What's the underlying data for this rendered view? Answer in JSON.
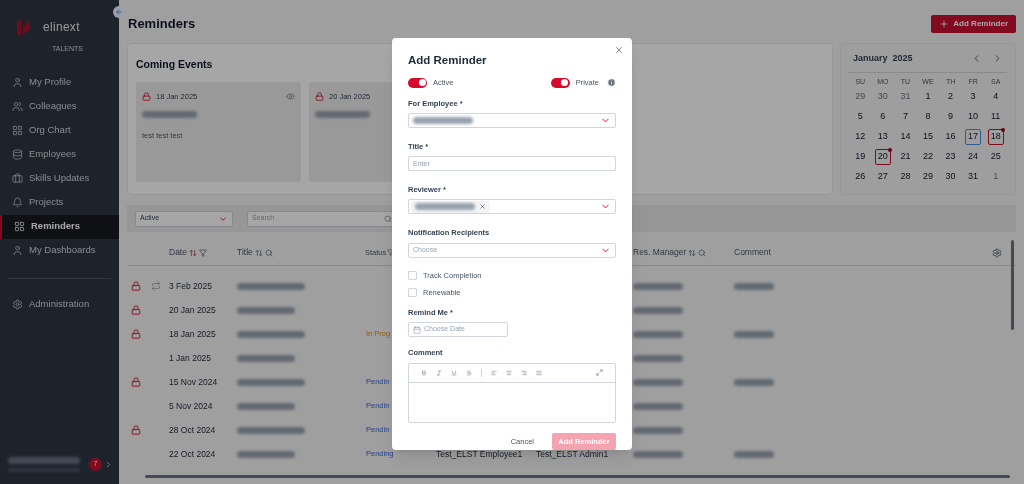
{
  "sidebar": {
    "logo": "elinext",
    "subtitle": "TALENTS",
    "items": [
      {
        "label": "My Profile",
        "selected": false
      },
      {
        "label": "Colleagues",
        "selected": false
      },
      {
        "label": "Org Chart",
        "selected": false
      },
      {
        "label": "Employees",
        "selected": false
      },
      {
        "label": "Skills Updates",
        "selected": false
      },
      {
        "label": "Projects",
        "selected": false
      },
      {
        "label": "Reminders",
        "selected": true
      },
      {
        "label": "My Dashboards",
        "selected": false
      }
    ],
    "admin": {
      "label": "Administration",
      "selected": false
    },
    "notification_count": "7"
  },
  "header": {
    "title": "Reminders",
    "add_button": "Add Reminder"
  },
  "coming_events": {
    "title": "Coming Events",
    "cards": [
      {
        "date": "18 Jan 2025",
        "private": true,
        "watched": true,
        "text": "test test test"
      },
      {
        "date": "20 Jan 2025",
        "private": true,
        "watched": false
      }
    ]
  },
  "calendar": {
    "month": "January",
    "year": "2025",
    "weekdays": [
      "SU",
      "MO",
      "TU",
      "WE",
      "TH",
      "FR",
      "SA"
    ],
    "weeks": [
      [
        {
          "day": "29",
          "outside": true,
          "today": false,
          "event": false
        },
        {
          "day": "30",
          "outside": true,
          "today": false,
          "event": false
        },
        {
          "day": "31",
          "outside": true,
          "today": false,
          "event": false
        },
        {
          "day": "1",
          "outside": false,
          "today": false,
          "event": false
        },
        {
          "day": "2",
          "outside": false,
          "today": false,
          "event": false
        },
        {
          "day": "3",
          "outside": false,
          "today": false,
          "event": false
        },
        {
          "day": "4",
          "outside": false,
          "today": false,
          "event": false
        }
      ],
      [
        {
          "day": "5",
          "outside": false,
          "today": false,
          "event": false
        },
        {
          "day": "6",
          "outside": false,
          "today": false,
          "event": false
        },
        {
          "day": "7",
          "outside": false,
          "today": false,
          "event": false
        },
        {
          "day": "8",
          "outside": false,
          "today": false,
          "event": false
        },
        {
          "day": "9",
          "outside": false,
          "today": false,
          "event": false
        },
        {
          "day": "10",
          "outside": false,
          "today": false,
          "event": false
        },
        {
          "day": "11",
          "outside": false,
          "today": false,
          "event": false
        }
      ],
      [
        {
          "day": "12",
          "outside": false,
          "today": false,
          "event": false
        },
        {
          "day": "13",
          "outside": false,
          "today": false,
          "event": false
        },
        {
          "day": "14",
          "outside": false,
          "today": false,
          "event": false
        },
        {
          "day": "15",
          "outside": false,
          "today": false,
          "event": false
        },
        {
          "day": "16",
          "outside": false,
          "today": false,
          "event": false
        },
        {
          "day": "17",
          "outside": false,
          "today": true,
          "event": false
        },
        {
          "day": "18",
          "outside": false,
          "today": false,
          "event": true
        }
      ],
      [
        {
          "day": "19",
          "outside": false,
          "today": false,
          "event": false
        },
        {
          "day": "20",
          "outside": false,
          "today": false,
          "event": true
        },
        {
          "day": "21",
          "outside": false,
          "today": false,
          "event": false
        },
        {
          "day": "22",
          "outside": false,
          "today": false,
          "event": false
        },
        {
          "day": "23",
          "outside": false,
          "today": false,
          "event": false
        },
        {
          "day": "24",
          "outside": false,
          "today": false,
          "event": false
        },
        {
          "day": "25",
          "outside": false,
          "today": false,
          "event": false
        }
      ],
      [
        {
          "day": "26",
          "outside": false,
          "today": false,
          "event": false
        },
        {
          "day": "27",
          "outside": false,
          "today": false,
          "event": false
        },
        {
          "day": "28",
          "outside": false,
          "today": false,
          "event": false
        },
        {
          "day": "29",
          "outside": false,
          "today": false,
          "event": false
        },
        {
          "day": "30",
          "outside": false,
          "today": false,
          "event": false
        },
        {
          "day": "31",
          "outside": false,
          "today": false,
          "event": false
        },
        {
          "day": "1",
          "outside": true,
          "today": false,
          "event": false
        }
      ]
    ]
  },
  "filters": {
    "status": "Active",
    "search_placeholder": "Search"
  },
  "table": {
    "columns": [
      "Date",
      "Title",
      "Status",
      "Res. Manager",
      "Comment"
    ],
    "rows": [
      {
        "private": true,
        "recurring": true,
        "date": "3 Feb 2025",
        "comment_blurred": true
      },
      {
        "private": true,
        "recurring": false,
        "date": "20 Jan 2025",
        "comment_blurred": false
      },
      {
        "private": true,
        "recurring": false,
        "date": "18 Jan 2025",
        "status": {
          "text": "In Prog",
          "kind": "in_progress"
        },
        "comment_blurred": true
      },
      {
        "private": false,
        "recurring": false,
        "date": "1 Jan 2025",
        "comment_blurred": false
      },
      {
        "private": true,
        "recurring": false,
        "date": "15 Nov 2024",
        "status": {
          "text": "Pendin",
          "kind": "pending"
        },
        "comment_blurred": true
      },
      {
        "private": false,
        "recurring": false,
        "date": "5 Nov 2024",
        "status": {
          "text": "Pendin",
          "kind": "pending"
        },
        "comment_blurred": false
      },
      {
        "private": true,
        "recurring": false,
        "date": "28 Oct 2024",
        "status": {
          "text": "Pendin",
          "kind": "pending"
        },
        "comment_blurred": false
      },
      {
        "private": false,
        "recurring": false,
        "date": "22 Oct 2024",
        "status": {
          "text": "Pending",
          "kind": "pending"
        },
        "column_5": "Test_ELST Employee1",
        "column_6": "Test_ELST Admin1",
        "comment_blurred": true
      }
    ]
  },
  "dialog": {
    "title": "Add Reminder",
    "active": {
      "label": "Active",
      "on": true
    },
    "private": {
      "label": "Private",
      "on": true
    },
    "employee_label": "For Employee *",
    "title_label": "Title *",
    "title_placeholder": "Enter",
    "reviewer_label": "Reviewer *",
    "recipients_label": "Notification Recipients",
    "recipients_placeholder": "Choose",
    "checkboxes": [
      {
        "label": "Track Completion",
        "checked": false
      },
      {
        "label": "Renewable",
        "checked": false
      }
    ],
    "remind_label": "Remind Me *",
    "remind_placeholder": "Choose Date",
    "comment_label": "Comment",
    "cancel": "Cancel",
    "submit": {
      "label": "Add Reminder",
      "disabled": true
    }
  }
}
